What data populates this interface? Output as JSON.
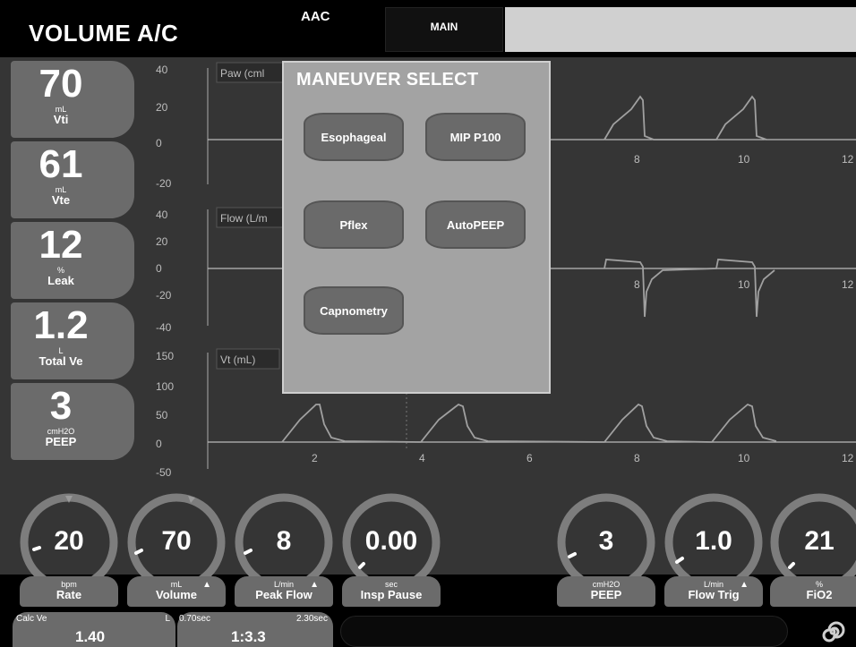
{
  "header": {
    "mode_title": "VOLUME A/C",
    "sub_mode": "AAC",
    "tab_main": "MAIN"
  },
  "monitors": [
    {
      "value": "70",
      "unit": "mL",
      "label": "Vti"
    },
    {
      "value": "61",
      "unit": "mL",
      "label": "Vte"
    },
    {
      "value": "12",
      "unit": "%",
      "label": "Leak"
    },
    {
      "value": "1.2",
      "unit": "L",
      "label": "Total Ve"
    },
    {
      "value": "3",
      "unit": "cmH2O",
      "label": "PEEP"
    }
  ],
  "waveforms": {
    "paw": {
      "label": "Paw (cml",
      "ticks": [
        "40",
        "20",
        "0",
        "-20"
      ]
    },
    "flow": {
      "label": "Flow (L/m",
      "ticks": [
        "40",
        "20",
        "0",
        "-20",
        "-40"
      ]
    },
    "vt": {
      "label": "Vt (mL)",
      "ticks": [
        "150",
        "100",
        "50",
        "0",
        "-50"
      ]
    },
    "time_ticks_top": [
      "8",
      "10",
      "12"
    ],
    "time_ticks_mid": [
      "8",
      "10",
      "12"
    ],
    "time_ticks_bottom": [
      "2",
      "4",
      "6",
      "8",
      "10",
      "12"
    ],
    "color": "#9a9a9a"
  },
  "maneuver": {
    "title": "MANEUVER SELECT",
    "buttons": {
      "esophageal": "Esophageal",
      "mip_p100": "MIP P100",
      "pflex": "Pflex",
      "autopeep": "AutoPEEP",
      "capnometry": "Capnometry"
    }
  },
  "knobs": [
    {
      "value": "20",
      "unit": "bpm",
      "label": "Rate",
      "arrow": false
    },
    {
      "value": "70",
      "unit": "mL",
      "label": "Volume",
      "arrow": true
    },
    {
      "value": "8",
      "unit": "L/min",
      "label": "Peak Flow",
      "arrow": true
    },
    {
      "value": "0.00",
      "unit": "sec",
      "label": "Insp Pause",
      "arrow": false
    },
    {
      "value": "3",
      "unit": "cmH2O",
      "label": "PEEP",
      "arrow": false
    },
    {
      "value": "1.0",
      "unit": "L/min",
      "label": "Flow Trig",
      "arrow": true
    },
    {
      "value": "21",
      "unit": "%",
      "label": "FiO2",
      "arrow": false
    }
  ],
  "status": {
    "calc_ve_label": "Calc Ve",
    "calc_ve_unit": "L",
    "calc_ve_value": "1.40",
    "ti": "0.70sec",
    "te": "2.30sec",
    "ie_ratio": "1:3.3"
  },
  "colors": {
    "tile": "#6b6b6b",
    "background": "#353535",
    "dialog": "#a3a3a3"
  }
}
